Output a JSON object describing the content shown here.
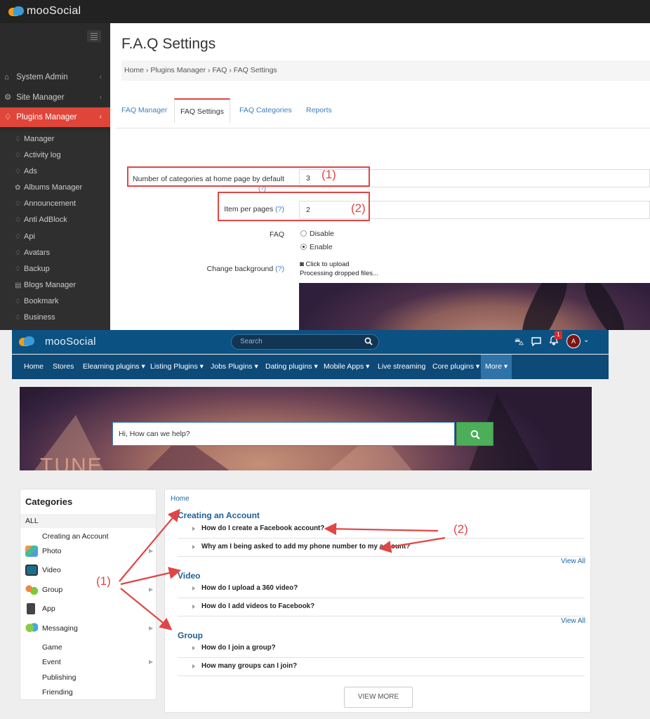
{
  "admin": {
    "brand": "mooSocial",
    "sidebar": {
      "sections": [
        {
          "label": "System Admin",
          "icon": "home-icon"
        },
        {
          "label": "Site Manager",
          "icon": "gears-icon"
        },
        {
          "label": "Plugins Manager",
          "icon": "tag-icon",
          "active": true
        }
      ],
      "items": [
        "Manager",
        "Activity log",
        "Ads",
        "Albums Manager",
        "Announcement",
        "Anti AdBlock",
        "Api",
        "Avatars",
        "Backup",
        "Blogs Manager",
        "Bookmark",
        "Business"
      ]
    },
    "page_title": "F.A.Q Settings",
    "breadcrumb": "Home › Plugins Manager › FAQ › FAQ Settings",
    "tabs": [
      "FAQ Manager",
      "FAQ Settings",
      "FAQ Categories",
      "Reports"
    ],
    "active_tab": "FAQ Settings",
    "form": {
      "categories_label": "Number of categories at home page by default",
      "categories_help": "(?)",
      "categories_value": "3",
      "items_label": "Item per pages",
      "items_help": "(?)",
      "items_value": "2",
      "faq_label": "FAQ",
      "faq_options": [
        "Disable",
        "Enable"
      ],
      "faq_selected": "Enable",
      "background_label": "Change background",
      "background_help": "(?)",
      "upload_text": "Click to upload",
      "processing_text": "Processing dropped files..."
    },
    "annotations": {
      "one": "(1)",
      "two": "(2)"
    }
  },
  "front": {
    "brand": "mooSocial",
    "search_placeholder": "Search",
    "notification_count": "1",
    "avatar_letter": "A",
    "nav": [
      "Home",
      "Stores",
      "Elearning plugins ▾",
      "Listing Plugins ▾",
      "Jobs Plugins ▾",
      "Dating plugins ▾",
      "Mobile Apps ▾",
      "Live streaming",
      "Core plugins ▾",
      "More ▾"
    ],
    "hero_placeholder": "Hi, How can we help?",
    "hero_text": "TUNE",
    "categories": {
      "title": "Categories",
      "all": "ALL",
      "items": [
        {
          "label": "Creating an Account",
          "icon": "",
          "arrow": false
        },
        {
          "label": "Photo",
          "icon": "photo-icon",
          "arrow": true
        },
        {
          "label": "Video",
          "icon": "video-icon",
          "arrow": false
        },
        {
          "label": "Group",
          "icon": "group-icon",
          "arrow": true
        },
        {
          "label": "App",
          "icon": "app-icon",
          "arrow": false
        },
        {
          "label": "Messaging",
          "icon": "messaging-icon",
          "arrow": true
        },
        {
          "label": "Game",
          "icon": "",
          "arrow": false
        },
        {
          "label": "Event",
          "icon": "",
          "arrow": true
        },
        {
          "label": "Publishing",
          "icon": "",
          "arrow": false
        },
        {
          "label": "Friending",
          "icon": "",
          "arrow": false
        }
      ]
    },
    "faq": {
      "home": "Home",
      "groups": [
        {
          "title": "Creating an Account",
          "questions": [
            "How do I create a Facebook account?",
            "Why am I being asked to add my phone number to my account?"
          ],
          "view_all": "View All"
        },
        {
          "title": "Video",
          "questions": [
            "How do I upload a 360 video?",
            "How do I add videos to Facebook?"
          ],
          "view_all": "View All"
        },
        {
          "title": "Group",
          "questions": [
            "How do I join a group?",
            "How many groups can I join?"
          ]
        }
      ],
      "view_more": "VIEW MORE"
    },
    "annotations": {
      "one": "(1)",
      "two": "(2)"
    }
  },
  "colors": {
    "accent_red": "#e0453a",
    "header_blue": "#0b5283",
    "link_blue": "#1f66a3",
    "annotation_red": "#e04646"
  }
}
